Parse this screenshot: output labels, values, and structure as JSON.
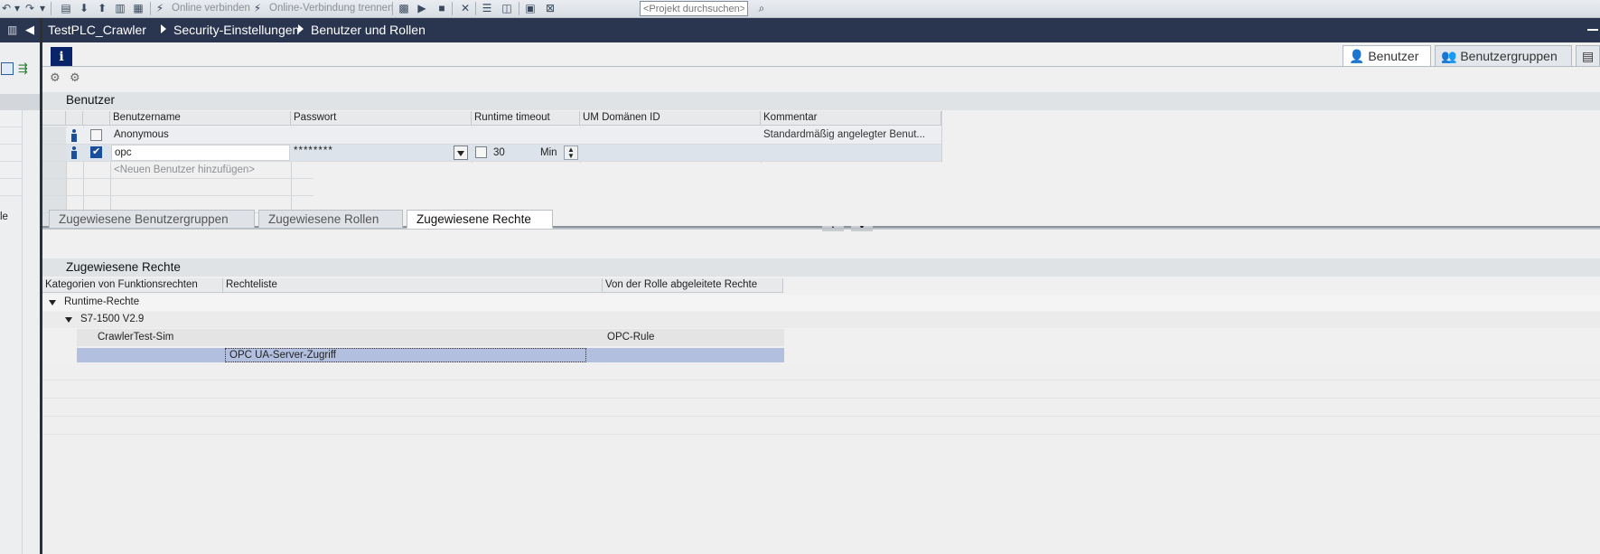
{
  "toolbar": {
    "online_connect": "Online verbinden",
    "online_disconnect": "Online-Verbindung trennen",
    "search_placeholder": "<Projekt durchsuchen>"
  },
  "breadcrumb": [
    "TestPLC_Crawler",
    "Security-Einstellungen",
    "Benutzer und Rollen"
  ],
  "info_label": "i",
  "right_tabs": [
    "Benutzer",
    "Benutzergruppen"
  ],
  "users_section": {
    "title": "Benutzer",
    "columns": [
      "Benutzername",
      "Passwort",
      "Runtime timeout",
      "UM Domänen ID",
      "Kommentar"
    ],
    "rows": [
      {
        "username": "Anonymous",
        "password": "",
        "timeout": "",
        "unit": "",
        "domain_id": "",
        "comment": "Standardmäßig angelegter Benut...",
        "checked": false
      },
      {
        "username": "opc",
        "password": "********",
        "timeout": "30",
        "unit": "Min",
        "domain_id": "",
        "comment": "",
        "checked": true
      }
    ],
    "add_placeholder": "<Neuen Benutzer hinzufügen>"
  },
  "bottom_tabs": [
    "Zugewiesene Benutzergruppen",
    "Zugewiesene Rollen",
    "Zugewiesene Rechte"
  ],
  "rights_section": {
    "title": "Zugewiesene Rechte",
    "columns": [
      "Kategorien von Funktionsrechten",
      "Rechteliste",
      "Von der Rolle abgeleitete Rechte"
    ],
    "tree": {
      "root": "Runtime-Rechte",
      "child": "S7-1500 V2.9",
      "leaf": "CrawlerTest-Sim",
      "leaf_role": "OPC-Rule",
      "right": "OPC UA-Server-Zugriff"
    }
  },
  "sidebar": {
    "fragment": "le"
  }
}
